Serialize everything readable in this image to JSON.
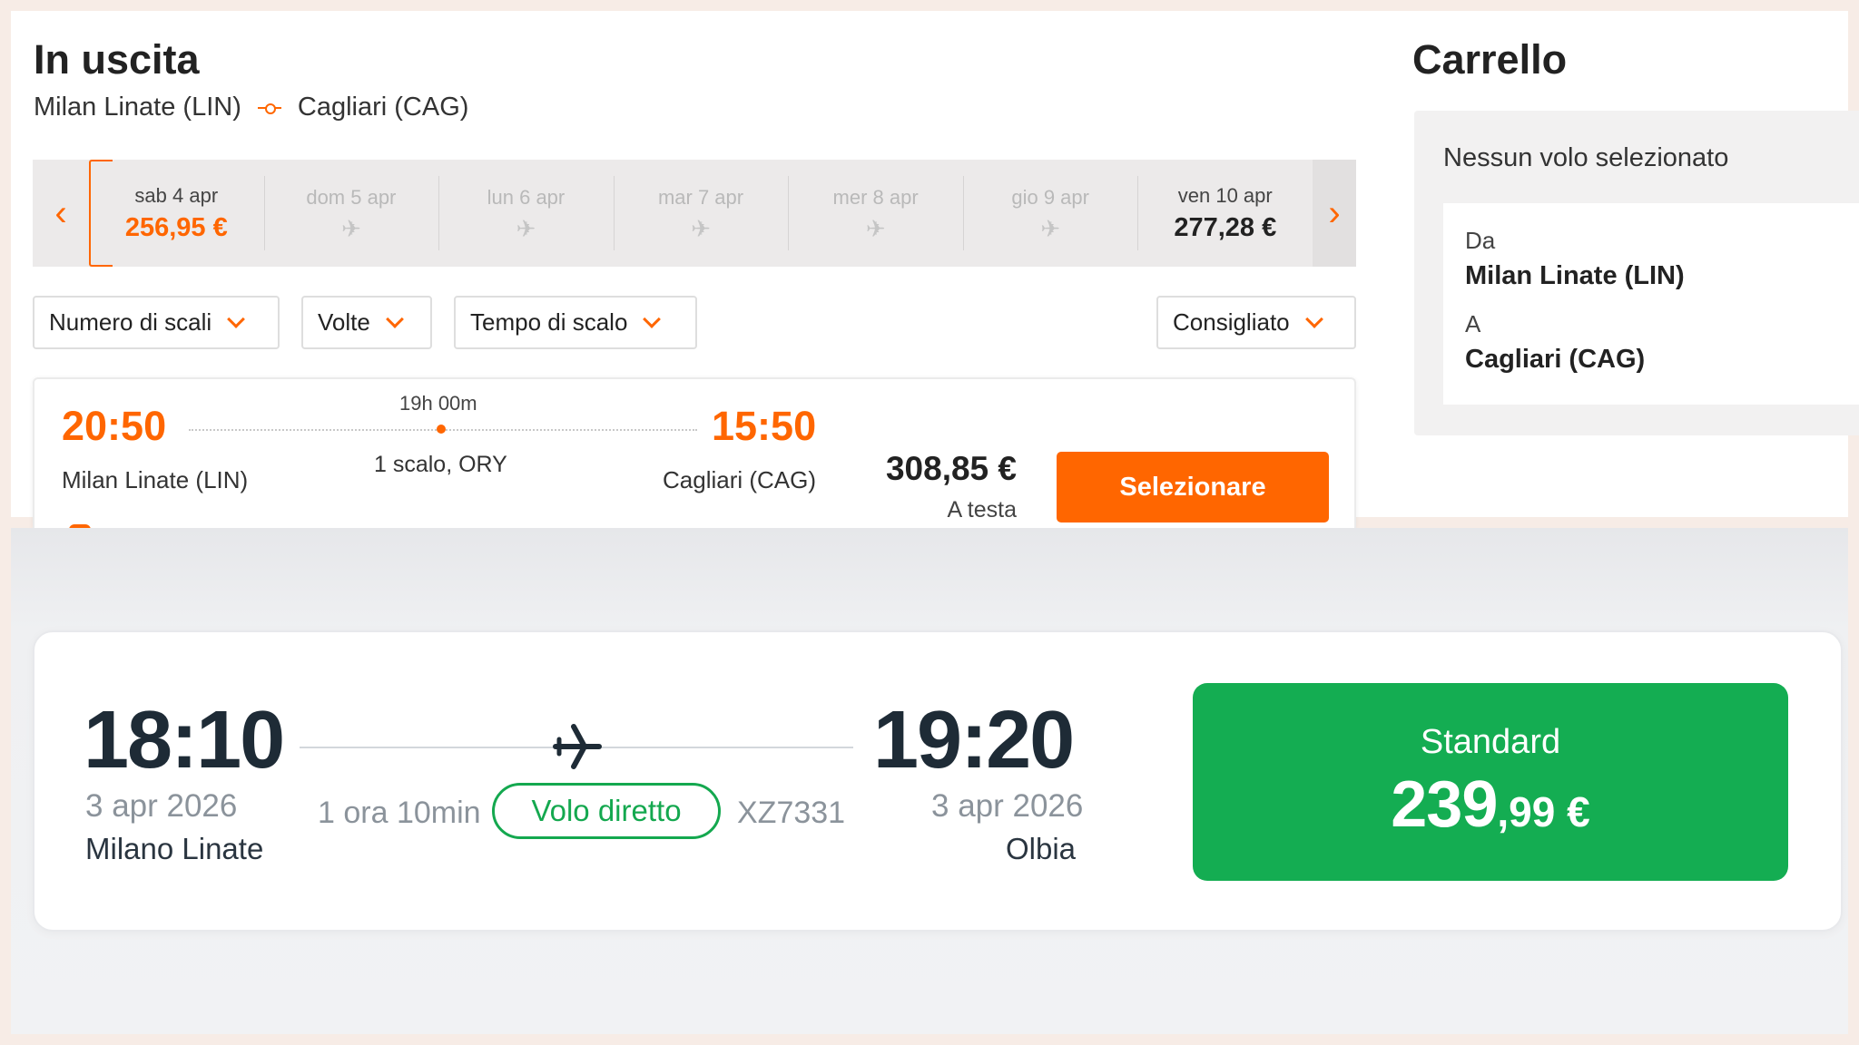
{
  "outbound": {
    "title": "In uscita",
    "origin": "Milan Linate (LIN)",
    "destination": "Cagliari (CAG)",
    "dates": [
      {
        "day": "sab 4 apr",
        "price": "256,95 €",
        "selected": true
      },
      {
        "day": "dom 5 apr",
        "price": "",
        "disabled": true
      },
      {
        "day": "lun 6 apr",
        "price": "",
        "disabled": true
      },
      {
        "day": "mar 7 apr",
        "price": "",
        "disabled": true
      },
      {
        "day": "mer 8 apr",
        "price": "",
        "disabled": true
      },
      {
        "day": "gio 9 apr",
        "price": "",
        "disabled": true
      },
      {
        "day": "ven 10 apr",
        "price": "277,28 €"
      }
    ],
    "filters": {
      "stops": "Numero di scali",
      "airlines": "Volte",
      "layover": "Tempo di scalo",
      "sort": "Consigliato"
    },
    "flight": {
      "depart_time": "20:50",
      "depart_place": "Milan Linate (LIN)",
      "duration": "19h 00m",
      "stops": "1 scalo, ORY",
      "arrive_time": "15:50",
      "arrive_place": "Cagliari (CAG)",
      "price": "308,85 €",
      "price_note": "A testa",
      "select_label": "Selezionare"
    }
  },
  "cart": {
    "title": "Carrello",
    "empty_text": "Nessun volo selezionato",
    "from_label": "Da",
    "from_value": "Milan Linate (LIN)",
    "to_label": "A",
    "to_value": "Cagliari (CAG)"
  },
  "second_result": {
    "depart_time": "18:10",
    "depart_date": "3 apr 2026",
    "depart_city": "Milano Linate",
    "duration": "1 ora 10min",
    "direct_label": "Volo diretto",
    "flight_code": "XZ7331",
    "arrive_time": "19:20",
    "arrive_date": "3 apr 2026",
    "arrive_city": "Olbia",
    "fare_name": "Standard",
    "fare_price_int": "239",
    "fare_price_dec": ",99 €"
  },
  "colors": {
    "accent_orange": "#ff6600",
    "accent_green": "#14ad52"
  },
  "icons": {
    "prev": "chevron-left-icon",
    "next": "chevron-right-icon",
    "unavailable": "plane-crossed-icon",
    "route": "route-connector-icon",
    "plane": "plane-icon"
  }
}
